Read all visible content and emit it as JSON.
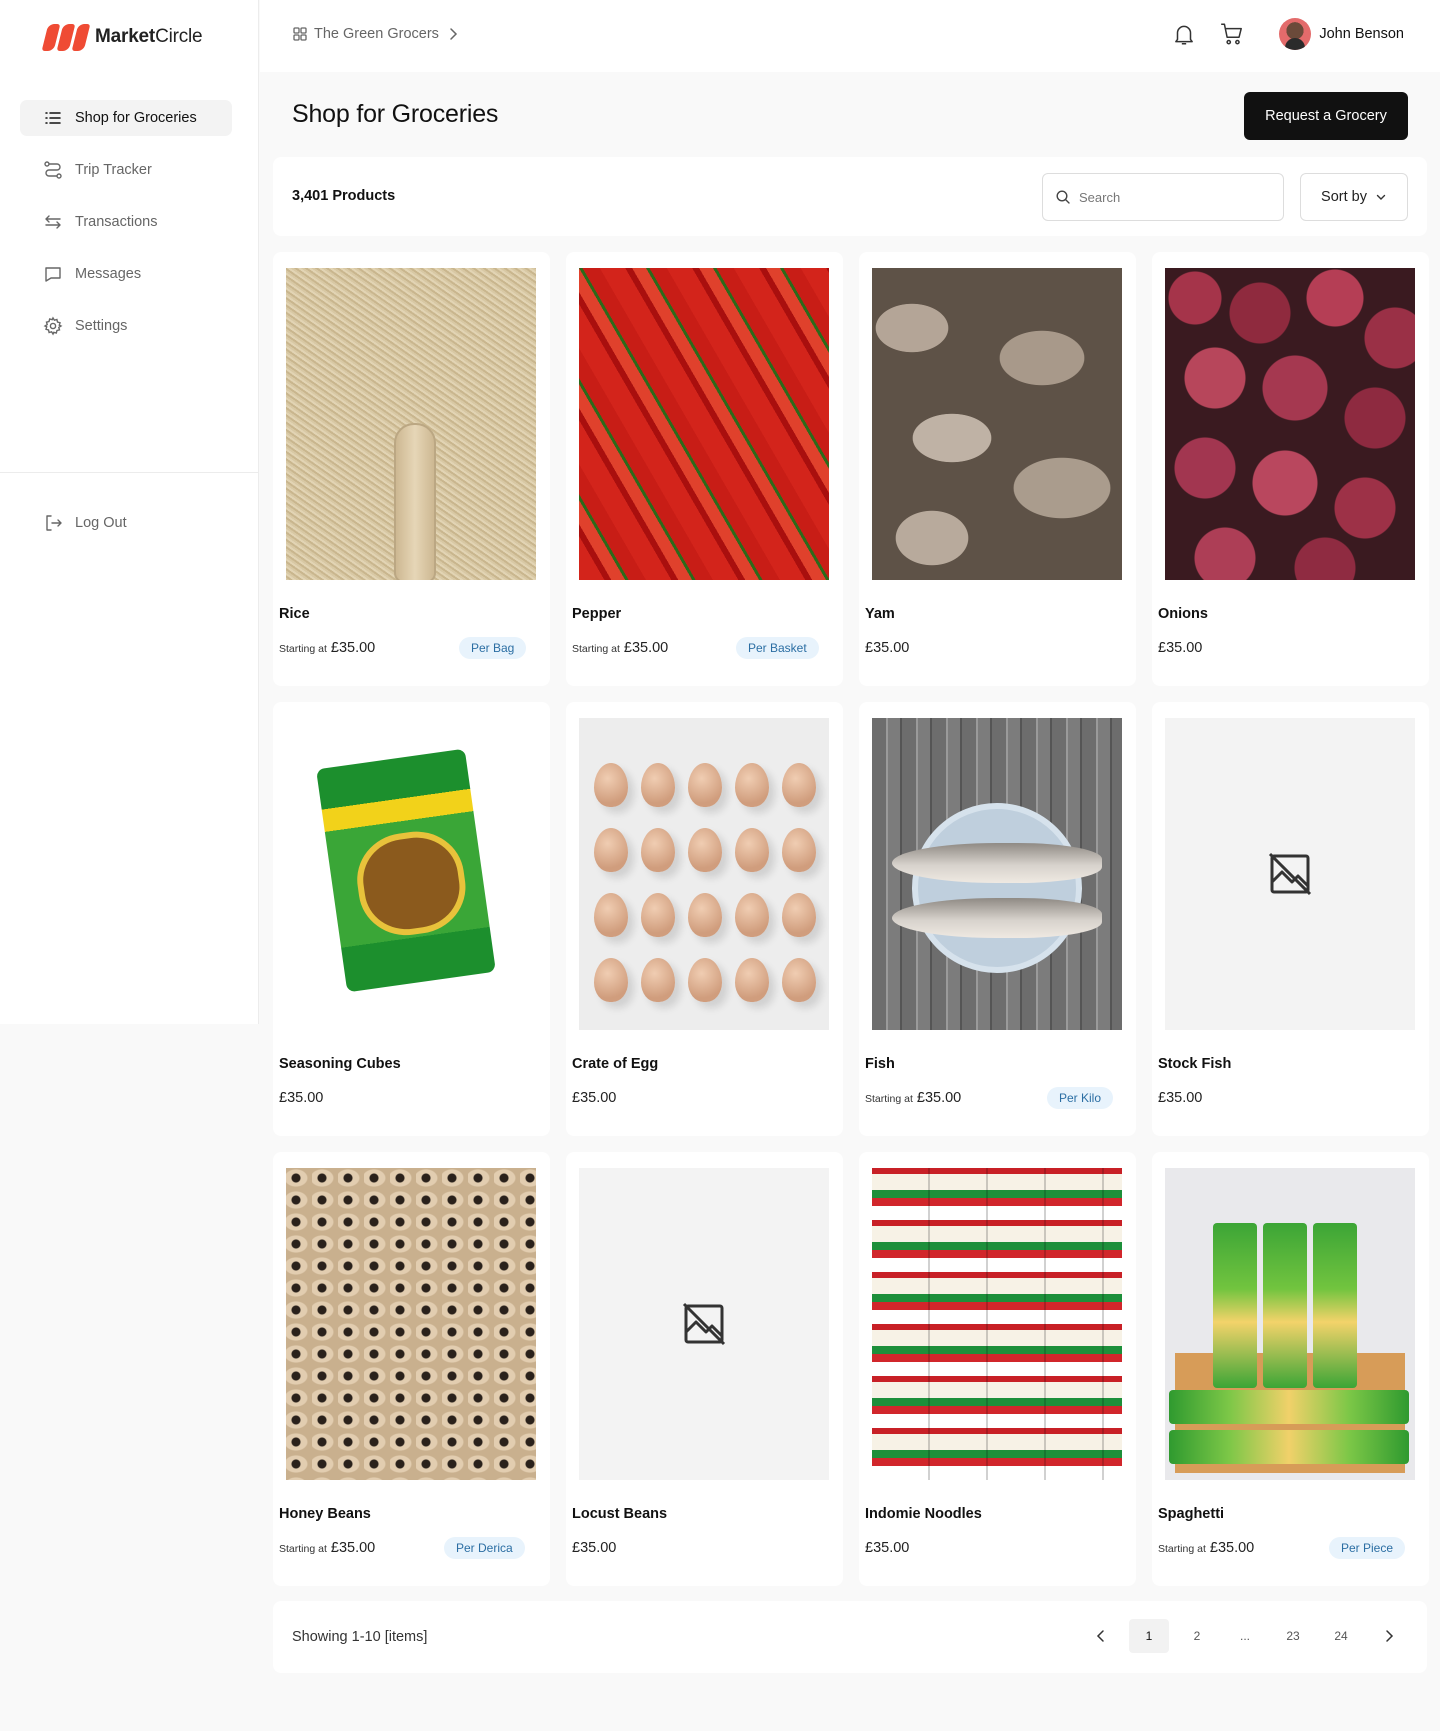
{
  "brand": {
    "name_part1": "Market",
    "name_part2": "Circle",
    "accent": "#ef4b34"
  },
  "sidebar": {
    "items": [
      {
        "label": "Shop for Groceries",
        "icon": "list-icon",
        "active": true
      },
      {
        "label": "Trip Tracker",
        "icon": "route-icon",
        "active": false
      },
      {
        "label": "Transactions",
        "icon": "swap-arrows-icon",
        "active": false
      },
      {
        "label": "Messages",
        "icon": "chat-bubble-icon",
        "active": false
      },
      {
        "label": "Settings",
        "icon": "gear-icon",
        "active": false
      }
    ],
    "logout": "Log Out"
  },
  "topbar": {
    "breadcrumb": "The Green Grocers",
    "user_name": "John Benson"
  },
  "header": {
    "title": "Shop for Groceries",
    "request_button": "Request a Grocery"
  },
  "filters": {
    "count": "3,401 Products",
    "search_placeholder": "Search",
    "sort_label": "Sort by"
  },
  "products": [
    {
      "name": "Rice",
      "from": "Starting at",
      "price": "£35.00",
      "unit": "Per Bag"
    },
    {
      "name": "Pepper",
      "from": "Starting at",
      "price": "£35.00",
      "unit": "Per Basket"
    },
    {
      "name": "Yam",
      "from": "",
      "price": "£35.00",
      "unit": ""
    },
    {
      "name": "Onions",
      "from": "",
      "price": "£35.00",
      "unit": ""
    },
    {
      "name": "Seasoning Cubes",
      "from": "",
      "price": "£35.00",
      "unit": ""
    },
    {
      "name": "Crate of Egg",
      "from": "",
      "price": "£35.00",
      "unit": ""
    },
    {
      "name": "Fish",
      "from": "Starting at",
      "price": "£35.00",
      "unit": "Per Kilo"
    },
    {
      "name": "Stock Fish",
      "from": "",
      "price": "£35.00",
      "unit": ""
    },
    {
      "name": "Honey Beans",
      "from": "Starting at",
      "price": "£35.00",
      "unit": "Per Derica"
    },
    {
      "name": "Locust Beans",
      "from": "",
      "price": "£35.00",
      "unit": ""
    },
    {
      "name": "Indomie Noodles",
      "from": "",
      "price": "£35.00",
      "unit": ""
    },
    {
      "name": "Spaghetti",
      "from": "Starting at",
      "price": "£35.00",
      "unit": "Per Piece"
    }
  ],
  "pagination": {
    "showing": "Showing 1-10 [items]",
    "pages": [
      "1",
      "2",
      "...",
      "23",
      "24"
    ],
    "current": "1"
  }
}
